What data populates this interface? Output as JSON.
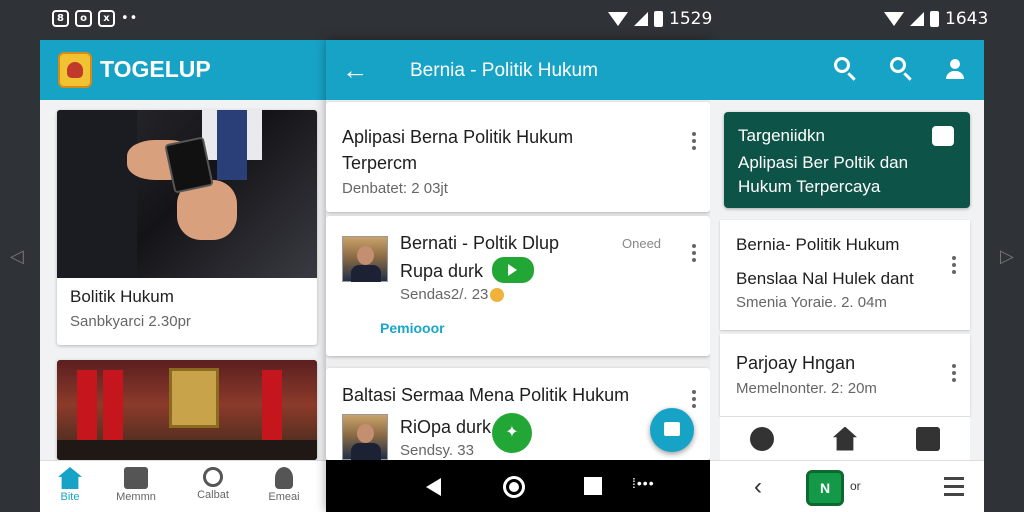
{
  "status_bar": {
    "left_icons": [
      "8",
      "o",
      "x"
    ],
    "dots": "••",
    "time_middle": "1529",
    "time_right": "1643"
  },
  "panel1": {
    "brand": "TOGELUP",
    "cards": [
      {
        "title": "Bolitik Hukum",
        "subtitle": "Sanbkyarci 2.30pr"
      },
      {
        "title": "",
        "subtitle": ""
      }
    ],
    "nav": [
      {
        "label": "Bite",
        "icon": "home-icon"
      },
      {
        "label": "Memmn",
        "icon": "newspaper-icon"
      },
      {
        "label": "Calbat",
        "icon": "search-icon"
      },
      {
        "label": "Emeai",
        "icon": "person-icon"
      }
    ]
  },
  "panel2": {
    "title": "Bernia - Politik Hukum",
    "items": [
      {
        "title": "Aplipasi Berna Politik Hukum",
        "title_line2": "Terpercm",
        "subtitle": "Denbatet: 2 03jt"
      },
      {
        "title": "Bernati - Poltik Dlup",
        "title_line2": "Rupa durk",
        "subtitle": "Sendas2/. 23",
        "badge": "Oneed",
        "link": "Pemiooor"
      },
      {
        "title": "Baltasi Sermaa Mena Politik Hukum",
        "title_line2": "RiOpa durk",
        "subtitle": "Sendsy. 33"
      }
    ]
  },
  "panel3": {
    "banner": {
      "title": "Targeniidkn",
      "line1": "Aplipasi Ber Poltik dan",
      "line2": "Hukum Terpercaya"
    },
    "items": [
      {
        "title": "Bernia- Politik Hukum",
        "title_line2": "",
        "subtitle": ""
      },
      {
        "title": "Benslaa Nal Hulek dant",
        "title_line2": "",
        "subtitle": "Smenia Yoraie. 2. 04m"
      },
      {
        "title": "Parjoay Hngan",
        "title_line2": "",
        "subtitle": "Memelnonter. 2: 20m"
      }
    ],
    "bottom_logo": "N",
    "bottom_label": "or"
  }
}
